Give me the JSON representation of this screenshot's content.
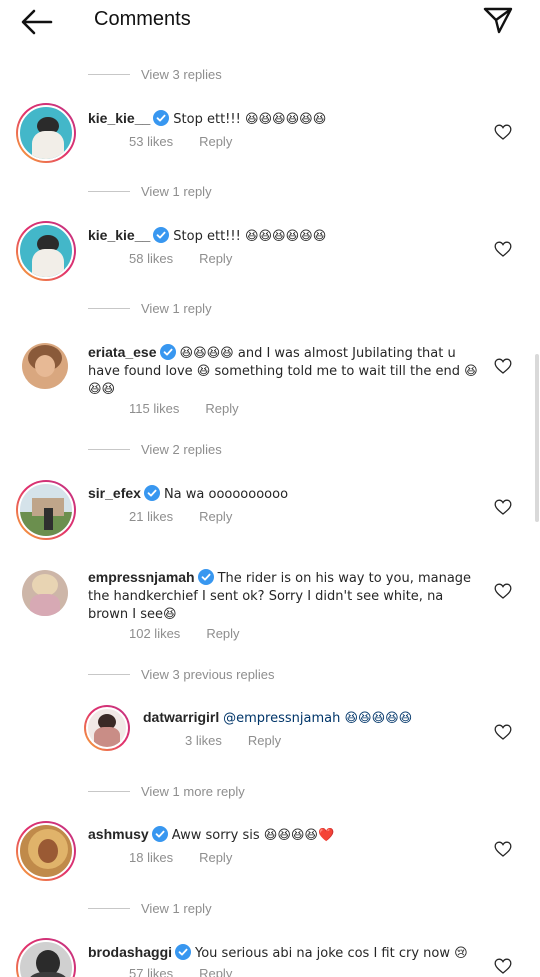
{
  "header": {
    "title": "Comments"
  },
  "links": {
    "view1": "View 3 replies",
    "view2": "View 1 reply",
    "view3": "View 1 reply",
    "view4": "View 2 replies",
    "view5": "View 3 previous replies",
    "view6": "View 1 more reply",
    "view7": "View 1 reply"
  },
  "comments": [
    {
      "username": "kie_kie__",
      "text": "Stop ett!!! 😆😆😆😆😆😆",
      "likes": "53 likes",
      "reply": "Reply"
    },
    {
      "username": "kie_kie__",
      "text": "Stop ett!!! 😆😆😆😆😆😆",
      "likes": "58 likes",
      "reply": "Reply"
    },
    {
      "username": "eriata_ese",
      "text": "😆😆😆😆 and I was almost Jubilating that u have found love 😆 something told me to wait till the end 😆😆😆",
      "likes": "115 likes",
      "reply": "Reply"
    },
    {
      "username": "sir_efex",
      "text": "Na wa oooooooooo",
      "likes": "21 likes",
      "reply": "Reply"
    },
    {
      "username": "empressnjamah",
      "text": "The rider is on his way to you, manage the handkerchief I sent ok? Sorry I didn't see white, na brown I see😆",
      "likes": "102 likes",
      "reply": "Reply"
    },
    {
      "username": "datwarrigirl",
      "text": "@empressnjamah 😆😆😆😆😆",
      "likes": "3 likes",
      "reply": "Reply"
    },
    {
      "username": "ashmusy",
      "text": "Aww sorry sis 😆😆😆😆❤️",
      "likes": "18 likes",
      "reply": "Reply"
    },
    {
      "username": "brodashaggi",
      "text": "You serious abi na joke cos I fit cry now 😢",
      "likes": "57 likes",
      "reply": "Reply"
    }
  ],
  "colors": {
    "text": "#262626",
    "muted": "#8e8e8e",
    "verified": "#3897f0",
    "heart_red": "#ed4956"
  }
}
